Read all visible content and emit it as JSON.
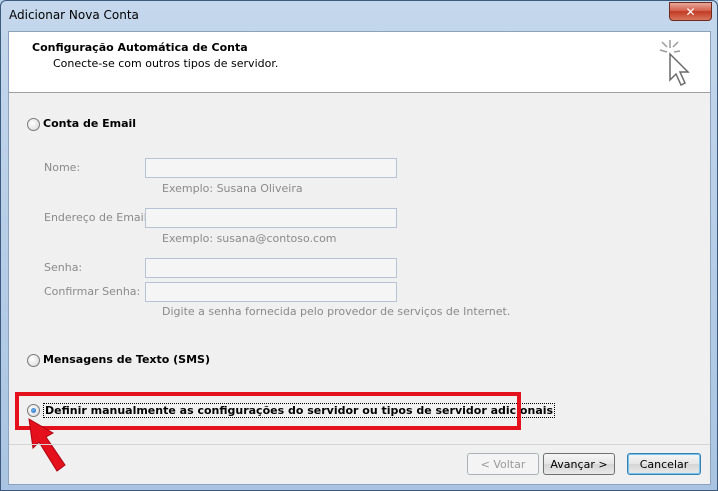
{
  "window": {
    "title": "Adicionar Nova Conta",
    "close_glyph": "✕"
  },
  "header": {
    "title": "Configuração Automática de Conta",
    "subtitle": "Conecte-se com outros tipos de servidor."
  },
  "options": {
    "email_account": {
      "label": "Conta de Email",
      "checked": false
    },
    "sms": {
      "label": "Mensagens de Texto (SMS)",
      "checked": false
    },
    "manual": {
      "label": "Definir manualmente as configurações do servidor ou tipos de servidor adicionais",
      "checked": true
    }
  },
  "form": {
    "name_label": "Nome:",
    "name_value": "",
    "name_hint": "Exemplo: Susana Oliveira",
    "email_label": "Endereço de Email:",
    "email_value": "",
    "email_hint": "Exemplo: susana@contoso.com",
    "password_label": "Senha:",
    "password_value": "",
    "confirm_label": "Confirmar Senha:",
    "confirm_value": "",
    "password_hint": "Digite a senha fornecida pelo provedor de serviços de Internet."
  },
  "buttons": {
    "back": "< Voltar",
    "next": "Avançar >",
    "cancel": "Cancelar"
  },
  "colors": {
    "highlight": "#e4101c",
    "accent": "#1c64c4"
  },
  "icons": {
    "wizard": "cursor-sparkle-icon",
    "annotation": "red-arrow-icon"
  }
}
